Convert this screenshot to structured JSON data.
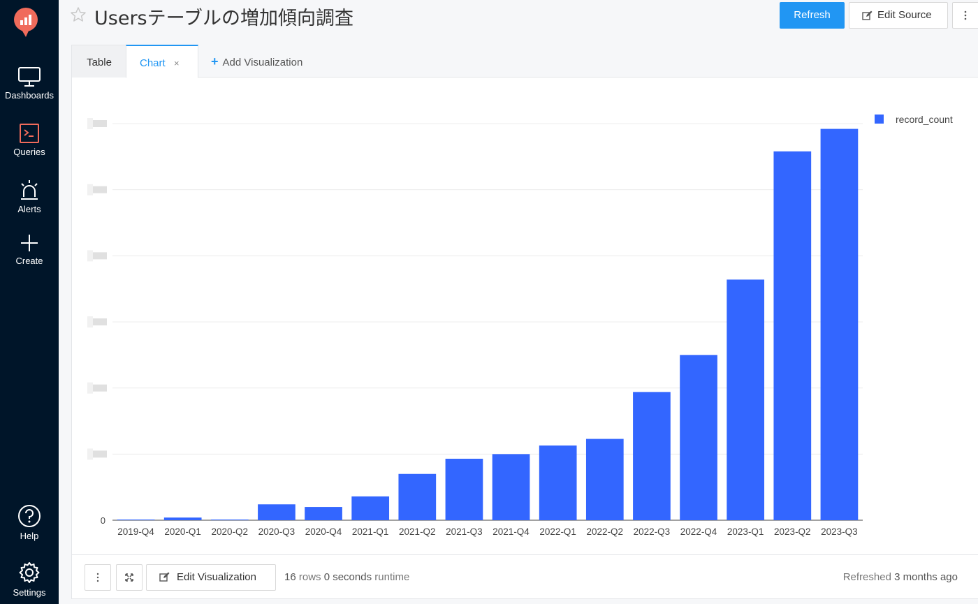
{
  "nav": {
    "items": [
      {
        "label": "Dashboards",
        "icon": "monitor-icon"
      },
      {
        "label": "Queries",
        "icon": "terminal-icon"
      },
      {
        "label": "Alerts",
        "icon": "siren-icon"
      },
      {
        "label": "Create",
        "icon": "plus-icon"
      },
      {
        "label": "Help",
        "icon": "help-icon"
      },
      {
        "label": "Settings",
        "icon": "gear-icon"
      }
    ]
  },
  "header": {
    "title": "Usersテーブルの増加傾向調査",
    "refresh_label": "Refresh",
    "edit_source_label": "Edit Source"
  },
  "tabs": {
    "table_label": "Table",
    "chart_label": "Chart",
    "close_label": "×",
    "add_label": "Add Visualization"
  },
  "footer": {
    "edit_vis_label": "Edit Visualization",
    "rows_count": "16",
    "rows_label": "rows",
    "runtime_value": "0 seconds",
    "runtime_label": "runtime",
    "refreshed_label": "Refreshed",
    "refreshed_value": "3 months ago"
  },
  "colors": {
    "bar": "#3366ff",
    "primary": "#2196f3",
    "sidebar": "#001529",
    "queries_icon": "#f06b5b"
  },
  "chart_data": {
    "type": "bar",
    "categories": [
      "2019-Q4",
      "2020-Q1",
      "2020-Q2",
      "2020-Q3",
      "2020-Q4",
      "2021-Q1",
      "2021-Q2",
      "2021-Q3",
      "2021-Q4",
      "2022-Q1",
      "2022-Q2",
      "2022-Q3",
      "2022-Q4",
      "2023-Q1",
      "2023-Q2",
      "2023-Q3"
    ],
    "series": [
      {
        "name": "record_count",
        "values": [
          0.1,
          0.4,
          0.1,
          2.4,
          2.0,
          3.6,
          7.0,
          9.3,
          10.0,
          11.3,
          12.3,
          19.4,
          25.0,
          36.4,
          55.8,
          59.2
        ]
      }
    ],
    "ylim": [
      0,
      60
    ],
    "y_tick_count": 7,
    "y_zero_label": "0",
    "y_other_tick_labels_obscured": true,
    "legend_position": "top-right",
    "grid": true
  }
}
